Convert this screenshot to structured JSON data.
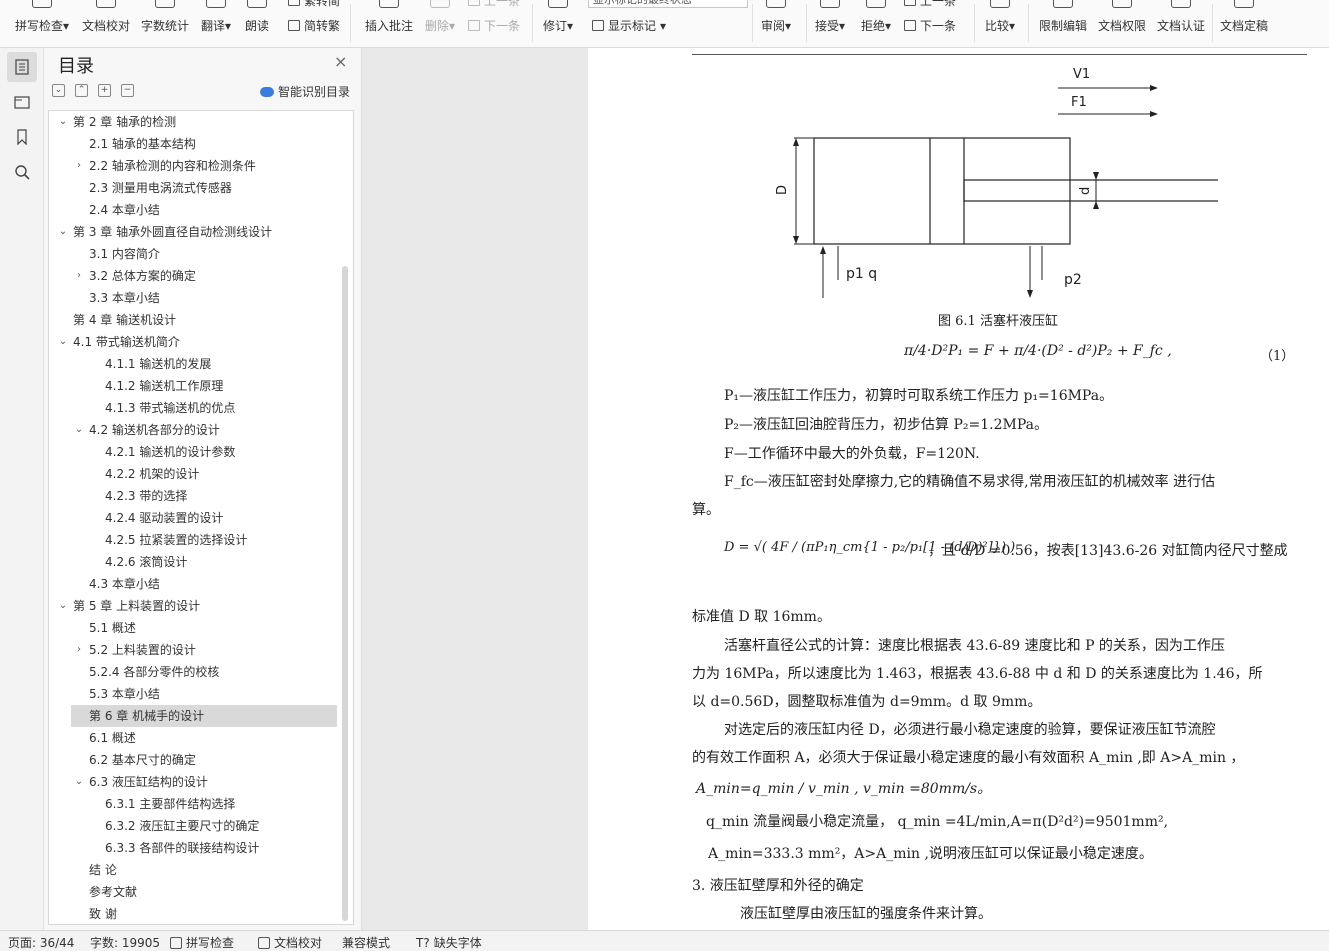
{
  "ribbon": {
    "spell_check": "拼写检查",
    "doc_proofread": "文档校对",
    "word_count": "字数统计",
    "translate": "翻译",
    "read_aloud": "朗读",
    "trad_to_simp": "繁转简",
    "simp_to_trad": "简转繁",
    "insert_comment": "插入批注",
    "delete": "删除",
    "prev_comment": "上一条",
    "next_comment": "下一条",
    "revise": "修订",
    "markup_state": "显示标记的最终状态",
    "show_markup": "显示标记",
    "review": "审阅",
    "accept": "接受",
    "reject": "拒绝",
    "prev_change": "上一条",
    "next_change": "下一条",
    "compare": "比较",
    "restrict_edit": "限制编辑",
    "doc_permission": "文档权限",
    "doc_certify": "文档认证",
    "doc_finalize": "文档定稿"
  },
  "toc": {
    "title": "目录",
    "close": "×",
    "ai_recognize": "智能识别目录",
    "items": [
      {
        "text": "第 2 章  轴承的检测",
        "level": 1,
        "chev": "open"
      },
      {
        "text": "2.1  轴承的基本结构",
        "level": 2,
        "chev": ""
      },
      {
        "text": "2.2  轴承检测的内容和检测条件",
        "level": 2,
        "chev": "closed"
      },
      {
        "text": "2.3  测量用电涡流式传感器",
        "level": 2,
        "chev": ""
      },
      {
        "text": "2.4 本章小结",
        "level": 2,
        "chev": ""
      },
      {
        "text": "第 3 章  轴承外圆直径自动检测线设计",
        "level": 1,
        "chev": "open"
      },
      {
        "text": "3.1  内容简介",
        "level": 2,
        "chev": ""
      },
      {
        "text": "3.2 总体方案的确定",
        "level": 2,
        "chev": "closed"
      },
      {
        "text": "3.3 本章小结",
        "level": 2,
        "chev": ""
      },
      {
        "text": "第 4 章  输送机设计",
        "level": 1,
        "chev": ""
      },
      {
        "text": "4.1  带式输送机简介",
        "level": 1,
        "chev": "open"
      },
      {
        "text": "4.1.1 输送机的发展",
        "level": 3,
        "chev": ""
      },
      {
        "text": "4.1.2 输送机工作原理",
        "level": 3,
        "chev": ""
      },
      {
        "text": "4.1.3 带式输送机的优点",
        "level": 3,
        "chev": ""
      },
      {
        "text": "4.2  输送机各部分的设计",
        "level": 2,
        "chev": "open"
      },
      {
        "text": "4.2.1 输送机的设计参数",
        "level": 3,
        "chev": ""
      },
      {
        "text": "4.2.2 机架的设计",
        "level": 3,
        "chev": ""
      },
      {
        "text": "4.2.3  带的选择",
        "level": 3,
        "chev": ""
      },
      {
        "text": "4.2.4  驱动装置的设计",
        "level": 3,
        "chev": ""
      },
      {
        "text": "4.2.5  拉紧装置的选择设计",
        "level": 3,
        "chev": ""
      },
      {
        "text": "4.2.6 滚筒设计",
        "level": 3,
        "chev": ""
      },
      {
        "text": "4.3 本章小结",
        "level": 2,
        "chev": ""
      },
      {
        "text": "第 5 章  上料装置的设计",
        "level": 1,
        "chev": "open"
      },
      {
        "text": "5.1  概述",
        "level": 2,
        "chev": ""
      },
      {
        "text": "5.2  上料装置的设计",
        "level": 2,
        "chev": "closed"
      },
      {
        "text": "5.2.4 各部分零件的校核",
        "level": 2,
        "chev": ""
      },
      {
        "text": "5.3 本章小结",
        "level": 2,
        "chev": ""
      },
      {
        "text": "第 6 章  机械手的设计",
        "level": 2,
        "chev": "",
        "selected": true
      },
      {
        "text": "6.1  概述",
        "level": 2,
        "chev": ""
      },
      {
        "text": "6.2 基本尺寸的确定",
        "level": 2,
        "chev": ""
      },
      {
        "text": "6.3 液压缸结构的设计",
        "level": 2,
        "chev": "open"
      },
      {
        "text": "6.3.1  主要部件结构选择",
        "level": 3,
        "chev": ""
      },
      {
        "text": "6.3.2 液压缸主要尺寸的确定",
        "level": 3,
        "chev": ""
      },
      {
        "text": "6.3.3  各部件的联接结构设计",
        "level": 3,
        "chev": ""
      },
      {
        "text": "结    论",
        "level": 2,
        "chev": ""
      },
      {
        "text": "参考文献",
        "level": 2,
        "chev": ""
      },
      {
        "text": "致    谢",
        "level": 2,
        "chev": ""
      }
    ]
  },
  "doc": {
    "fig_labels": {
      "v1": "V1",
      "f1": "F1",
      "D": "D",
      "d": "d",
      "p1q": "p1  q",
      "p2": "p2"
    },
    "caption": "图 6.1  活塞杆液压缸",
    "eq1": "π/4·D²P₁ = F + π/4·(D² - d²)P₂ + F_fc ,",
    "eq1_num": "（1）",
    "l1": "P₁—液压缸工作压力，初算时可取系统工作压力 p₁=16MPa。",
    "l2": "P₂—液压缸回油腔背压力，初步估算 P₂=1.2MPa。",
    "l3": "F—工作循环中最大的外负载，F=120N.",
    "l4": "F_fc—液压缸密封处摩擦力,它的精确值不易求得,常用液压缸的机械效率    进行估",
    "l5": "算。",
    "eq2": "D = √( 4F / (πP₁η_cm{1 - p₂/p₁[1 - (d/D)²]}) )",
    "eq2_tail": "，且 d/D =0.56，按表[13]43.6-26 对缸筒内径尺寸整成",
    "l6": "标准值 D 取 16mm。",
    "l7": "活塞杆直径公式的计算：速度比根据表 43.6-89 速度比和 P 的关系，因为工作压",
    "l8": "力为 16MPa，所以速度比为 1.463，根据表 43.6-88 中 d 和 D 的关系速度比为 1.46，所",
    "l9": "以 d=0.56D，圆整取标准值为 d=9mm。d 取 9mm。",
    "l10": "对选定后的液压缸内径 D，必须进行最小稳定速度的验算，要保证液压缸节流腔",
    "l11": "的有效工作面积 A，必须大于保证最小稳定速度的最小有效面积 A_min ,即 A>A_min  ，",
    "l12": "A_min=q_min / v_min , v_min   =80mm/s。",
    "l13": "q_min 流量阀最小稳定流量， q_min =4L/min,A=π(D²d²)=9501mm²,",
    "l14": "A_min=333.3  mm²，A>A_min ,说明液压缸可以保证最小稳定速度。",
    "l15": "3. 液压缸壁厚和外径的确定",
    "l16": "液压缸壁厚由液压缸的强度条件来计算。"
  },
  "status": {
    "page": "页面: 36/44",
    "words": "字数: 19905",
    "spell": "拼写检查",
    "proof": "文档校对",
    "compat": "兼容模式",
    "missing_font": "缺失字体"
  }
}
